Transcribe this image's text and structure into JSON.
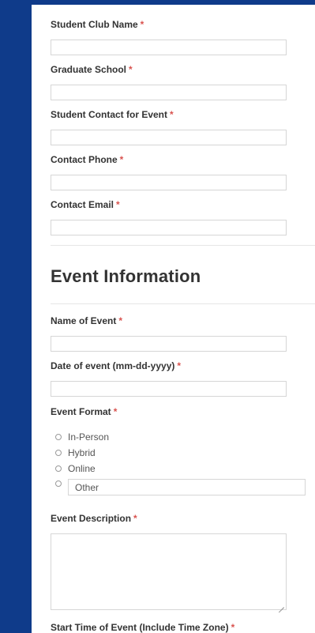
{
  "form": {
    "required_mark": "*",
    "fields": [
      {
        "label": "Student Club Name",
        "value": ""
      },
      {
        "label": "Graduate School",
        "value": ""
      },
      {
        "label": "Student Contact for Event",
        "value": ""
      },
      {
        "label": "Contact Phone",
        "value": ""
      },
      {
        "label": "Contact Email",
        "value": ""
      }
    ],
    "event_section": {
      "title": "Event Information",
      "name_of_event": {
        "label": "Name of Event",
        "value": ""
      },
      "date_of_event": {
        "label": "Date of event (mm-dd-yyyy)",
        "value": ""
      },
      "event_format": {
        "label": "Event Format",
        "options": [
          "In-Person",
          "Hybrid",
          "Online"
        ],
        "other_placeholder": "Other"
      },
      "event_description": {
        "label": "Event Description",
        "value": ""
      },
      "start_time": {
        "label": "Start Time of Event (Include Time Zone)"
      }
    }
  },
  "colors": {
    "background": "#0f3b8a",
    "panel": "#ffffff",
    "required": "#d9534f"
  }
}
